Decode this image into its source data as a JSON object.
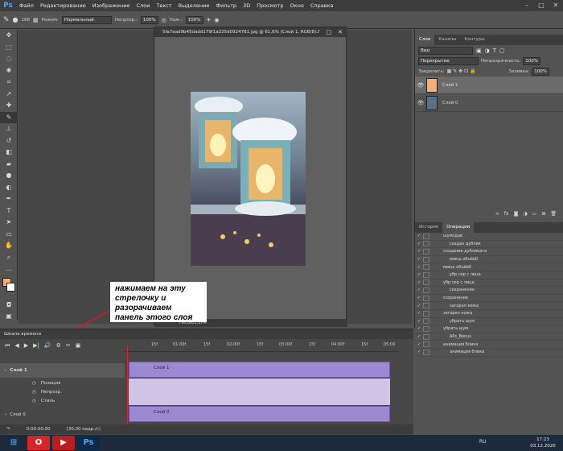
{
  "menubar": {
    "logo": "Ps",
    "items": [
      "Файл",
      "Редактирование",
      "Изображение",
      "Слои",
      "Текст",
      "Выделение",
      "Фильтр",
      "3D",
      "Просмотр",
      "Окно",
      "Справка"
    ]
  },
  "options": {
    "brush_size": "168",
    "mode_label": "Режим:",
    "mode_value": "Нормальный",
    "opacity_label": "Непрозр.:",
    "opacity_value": "100%",
    "press_label": "Наж.:",
    "press_value": "100%"
  },
  "document": {
    "title": "5fa7ead9b45dadd179f1a225d0924761.jpg @ 61,6% (Слой 1, RGB/8) *",
    "status": "79б,8K/1,37M"
  },
  "annotation": "нажимаем на эту стрелочку и разорачиваем панель этого слоя",
  "layers_panel": {
    "tabs": [
      "Слои",
      "Каналы",
      "Контуры"
    ],
    "filter_label": "Вид",
    "blend_mode": "Перекрытие",
    "opacity_label": "Непрозрачность:",
    "opacity_value": "100%",
    "lock_label": "Закрепить:",
    "fill_label": "Заливка:",
    "fill_value": "100%",
    "layers": [
      {
        "name": "Слой 1"
      },
      {
        "name": "Слой 0"
      }
    ]
  },
  "history_panel": {
    "tabs": [
      "История",
      "Операции"
    ],
    "rows": [
      "шумодав",
      "создан дублик",
      "создание дубликата",
      "микш объёв0",
      "микш объёв0",
      "убр сер с лица",
      "убр сер с лица",
      "сохранение",
      "сохранение",
      "загорел кожа",
      "загорел кожа",
      "убрать шум",
      "убрать шум",
      "APs_Bonus",
      "анимация блика",
      "анимация блика"
    ]
  },
  "timeline": {
    "title": "Шкала времени",
    "ticks": [
      "15f",
      "01:00f",
      "15f",
      "02:00f",
      "15f",
      "03:00f",
      "15f",
      "04:00f",
      "15f",
      "05:00"
    ],
    "layer1": "Слой 1",
    "props": [
      "Позиция",
      "Непрозр.",
      "Стиль"
    ],
    "layer0": "Слой 0",
    "timecode": "0:00:00:00",
    "fps": "(30,00 кадр./с)"
  },
  "taskbar": {
    "lang": "RU",
    "time": "17:23",
    "date": "03.12.2020"
  }
}
